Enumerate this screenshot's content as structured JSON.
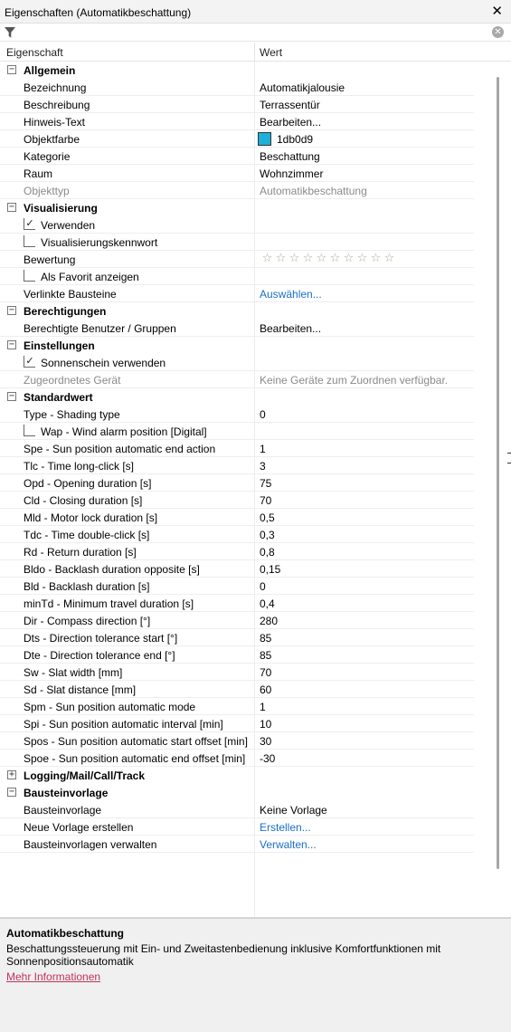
{
  "window": {
    "title": "Eigenschaften (Automatikbeschattung)"
  },
  "filter": {
    "placeholder": "",
    "value": ""
  },
  "columns": {
    "property": "Eigenschaft",
    "value": "Wert"
  },
  "rows": [
    {
      "type": "category",
      "label": "Allgemein",
      "expanded": true
    },
    {
      "type": "item",
      "label": "Bezeichnung",
      "value": "Automatikjalousie"
    },
    {
      "type": "item",
      "label": "Beschreibung",
      "value": "Terrassentür"
    },
    {
      "type": "item",
      "label": "Hinweis-Text",
      "value": "Bearbeiten..."
    },
    {
      "type": "color",
      "label": "Objektfarbe",
      "value": "1db0d9",
      "color": "#1db0d9"
    },
    {
      "type": "item",
      "label": "Kategorie",
      "value": "Beschattung"
    },
    {
      "type": "item",
      "label": "Raum",
      "value": "Wohnzimmer"
    },
    {
      "type": "item",
      "label": "Objekttyp",
      "value": "Automatikbeschattung",
      "disabled": true
    },
    {
      "type": "category",
      "label": "Visualisierung",
      "expanded": true
    },
    {
      "type": "check",
      "label": "Verwenden",
      "checked": true
    },
    {
      "type": "check",
      "label": "Visualisierungskennwort",
      "checked": false
    },
    {
      "type": "rating",
      "label": "Bewertung",
      "stars": 10,
      "rating": 0
    },
    {
      "type": "check",
      "label": "Als Favorit anzeigen",
      "checked": false
    },
    {
      "type": "item",
      "label": "Verlinkte Bausteine",
      "value": "Auswählen...",
      "link": true
    },
    {
      "type": "category",
      "label": "Berechtigungen",
      "expanded": true
    },
    {
      "type": "item",
      "label": "Berechtigte Benutzer / Gruppen",
      "value": "Bearbeiten..."
    },
    {
      "type": "category",
      "label": "Einstellungen",
      "expanded": true
    },
    {
      "type": "check",
      "label": "Sonnenschein verwenden",
      "checked": true
    },
    {
      "type": "item",
      "label": "Zugeordnetes Gerät",
      "value": "Keine Geräte zum Zuordnen verfügbar.",
      "disabled": true
    },
    {
      "type": "category",
      "label": "Standardwert",
      "expanded": true
    },
    {
      "type": "item",
      "label": "Type - Shading type",
      "value": "0"
    },
    {
      "type": "check",
      "label": "Wap - Wind alarm position [Digital]",
      "checked": false
    },
    {
      "type": "item",
      "label": "Spe - Sun position automatic end action",
      "value": "1"
    },
    {
      "type": "item",
      "label": "Tlc - Time long-click [s]",
      "value": "3"
    },
    {
      "type": "item",
      "label": "Opd - Opening duration [s]",
      "value": "75"
    },
    {
      "type": "item",
      "label": "Cld - Closing duration [s]",
      "value": "70"
    },
    {
      "type": "item",
      "label": "Mld - Motor lock duration [s]",
      "value": "0,5"
    },
    {
      "type": "item",
      "label": "Tdc - Time double-click [s]",
      "value": "0,3"
    },
    {
      "type": "item",
      "label": "Rd - Return duration [s]",
      "value": "0,8"
    },
    {
      "type": "item",
      "label": "Bldo - Backlash duration opposite [s]",
      "value": "0,15"
    },
    {
      "type": "item",
      "label": "Bld - Backlash duration [s]",
      "value": "0"
    },
    {
      "type": "item",
      "label": "minTd - Minimum travel duration [s]",
      "value": "0,4"
    },
    {
      "type": "item",
      "label": "Dir - Compass direction [°]",
      "value": "280"
    },
    {
      "type": "item",
      "label": "Dts - Direction tolerance start [°]",
      "value": "85"
    },
    {
      "type": "item",
      "label": "Dte - Direction tolerance end [°]",
      "value": "85"
    },
    {
      "type": "item",
      "label": "Sw - Slat width [mm]",
      "value": "70"
    },
    {
      "type": "item",
      "label": "Sd - Slat distance [mm]",
      "value": "60"
    },
    {
      "type": "item",
      "label": "Spm - Sun position automatic mode",
      "value": "1"
    },
    {
      "type": "item",
      "label": "Spi - Sun position automatic interval [min]",
      "value": "10"
    },
    {
      "type": "item",
      "label": "Spos - Sun position automatic start offset [min]",
      "value": "30"
    },
    {
      "type": "item",
      "label": "Spoe - Sun position automatic end offset [min]",
      "value": "-30"
    },
    {
      "type": "category",
      "label": "Logging/Mail/Call/Track",
      "expanded": false
    },
    {
      "type": "category",
      "label": "Bausteinvorlage",
      "expanded": true
    },
    {
      "type": "item",
      "label": "Bausteinvorlage",
      "value": "Keine Vorlage"
    },
    {
      "type": "item",
      "label": "Neue Vorlage erstellen",
      "value": "Erstellen...",
      "link": true
    },
    {
      "type": "item",
      "label": "Bausteinvorlagen verwalten",
      "value": "Verwalten...",
      "link": true
    }
  ],
  "description": {
    "title": "Automatikbeschattung",
    "text": "Beschattungssteuerung mit Ein- und Zweitastenbedienung inklusive Komfortfunktionen mit Sonnenpositionsautomatik",
    "link": "Mehr Informationen"
  },
  "colors": {
    "accent_link": "#1a6fc6",
    "info_link": "#c0335a"
  }
}
